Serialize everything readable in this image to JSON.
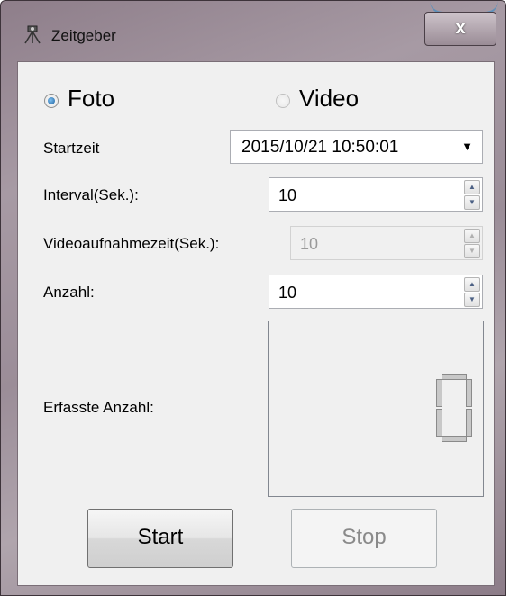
{
  "window": {
    "title": "Zeitgeber",
    "close_label": "x"
  },
  "mode": {
    "foto_label": "Foto",
    "video_label": "Video",
    "selected": "Foto"
  },
  "start_time": {
    "label": "Startzeit",
    "value": "2015/10/21 10:50:01"
  },
  "interval": {
    "label": "Interval(Sek.):",
    "value": "10"
  },
  "video_duration": {
    "label": "Videoaufnahmezeit(Sek.):",
    "value": "10"
  },
  "count": {
    "label": "Anzahl:",
    "value": "10"
  },
  "captured": {
    "label": "Erfasste Anzahl:",
    "value": "0"
  },
  "buttons": {
    "start": "Start",
    "stop": "Stop"
  },
  "icons": {
    "app": "camera-tripod-icon",
    "dropdown": "chevron-down-icon",
    "spin_up": "spin-up-icon",
    "spin_down": "spin-down-icon"
  }
}
